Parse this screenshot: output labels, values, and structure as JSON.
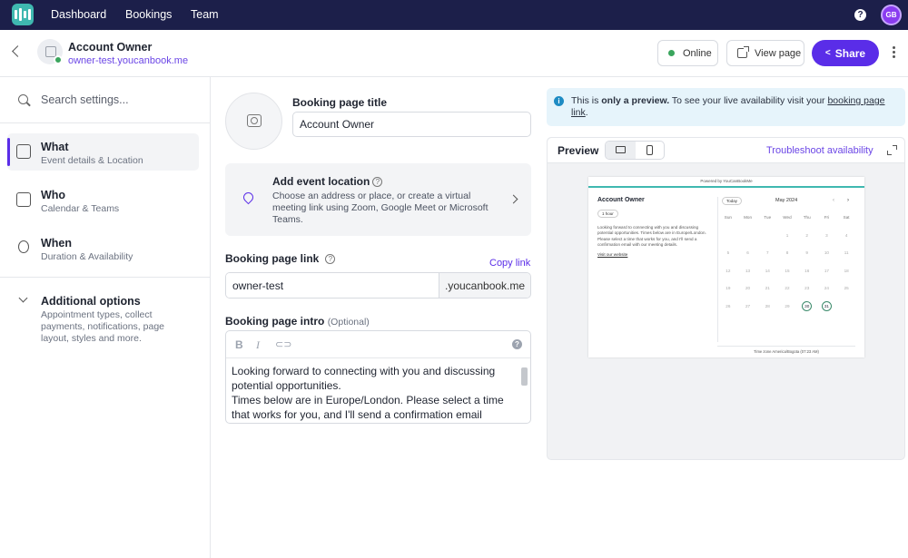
{
  "nav": {
    "links": [
      "Dashboard",
      "Bookings",
      "Team"
    ],
    "help_label": "?",
    "avatar_initials": "GB"
  },
  "header": {
    "account_name": "Account Owner",
    "account_url": "owner-test.youcanbook.me",
    "online_label": "Online",
    "view_page_label": "View page",
    "share_label": "Share"
  },
  "sidebar": {
    "search_placeholder": "Search settings...",
    "items": [
      {
        "title": "What",
        "subtitle": "Event details & Location"
      },
      {
        "title": "Who",
        "subtitle": "Calendar & Teams"
      },
      {
        "title": "When",
        "subtitle": "Duration & Availability"
      }
    ],
    "additional": {
      "title": "Additional options",
      "subtitle": "Appointment types, collect payments, notifications, page layout, styles and more."
    }
  },
  "form": {
    "title_label": "Booking page title",
    "title_value": "Account Owner",
    "location_title": "Add event location",
    "location_desc": "Choose an address or place, or create a virtual meeting link using Zoom, Google Meet or Microsoft Teams.",
    "link_label": "Booking page link",
    "copy_link": "Copy link",
    "link_value": "owner-test",
    "link_suffix": ".youcanbook.me",
    "intro_label": "Booking page intro",
    "intro_optional": "(Optional)",
    "intro_text_1": "Looking forward to connecting with you and discussing potential opportunities.",
    "intro_text_2": "Times below are in Europe/London. Please select a time that works for you, and I'll send a confirmation email"
  },
  "preview": {
    "notice_1": "This is ",
    "notice_bold": "only a preview.",
    "notice_2": " To see your live availability visit your ",
    "notice_link": "booking page link",
    "notice_end": ".",
    "label": "Preview",
    "troubleshoot": "Troubleshoot availability",
    "mini": {
      "powered": "Powered by YouCanBookMe",
      "title": "Account Owner",
      "duration": "1 hour",
      "desc": "Looking forward to connecting with you and discussing potential opportunities. Times below are in Europe/London. Please select a time that works for you, and I'll send a confirmation email with our meeting details.",
      "website": "Visit our website",
      "today": "Today",
      "month": "May 2024",
      "prev": "‹",
      "next": "›",
      "days": [
        "Sun",
        "Mon",
        "Tue",
        "Wed",
        "Thu",
        "Fri",
        "Sat"
      ],
      "dates": [
        "",
        "",
        "",
        "1",
        "2",
        "3",
        "4",
        "5",
        "6",
        "7",
        "8",
        "9",
        "10",
        "11",
        "12",
        "13",
        "14",
        "15",
        "16",
        "17",
        "18",
        "19",
        "20",
        "21",
        "22",
        "23",
        "24",
        "25",
        "26",
        "27",
        "28",
        "29",
        "30",
        "31",
        ""
      ],
      "available": [
        "30",
        "31"
      ],
      "timezone": "Time zone   America/Bogota (07:23 AM)"
    }
  }
}
